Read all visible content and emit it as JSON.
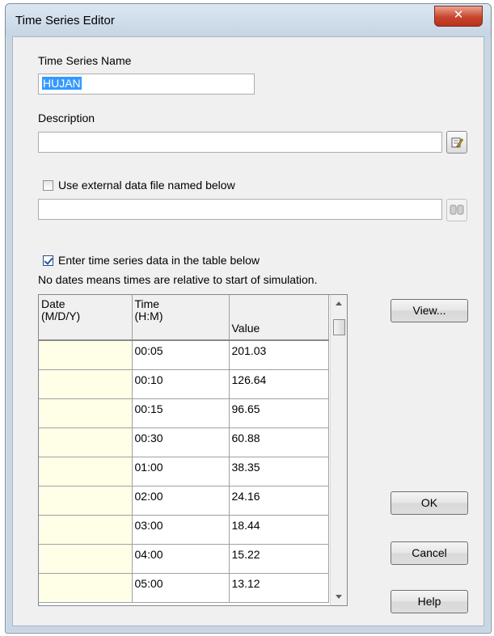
{
  "window": {
    "title": "Time Series Editor",
    "close_glyph": "✕"
  },
  "form": {
    "name_label": "Time Series Name",
    "name_value": "HUJAN",
    "description_label": "Description",
    "description_value": "",
    "edit_description_icon": "pencil-edit-icon",
    "use_external_label": "Use external data file named below",
    "use_external_checked": false,
    "external_file_value": "",
    "browse_file_icon": "binoculars-browse-icon",
    "enter_table_label": "Enter time series data in the table below",
    "enter_table_checked": true,
    "note": "No dates means times are relative to start of simulation."
  },
  "table": {
    "headers": {
      "date_line1": "Date",
      "date_line2": "(M/D/Y)",
      "time_line1": "Time",
      "time_line2": "(H:M)",
      "value": "Value"
    },
    "rows": [
      {
        "date": "",
        "time": "00:05",
        "value": "201.03"
      },
      {
        "date": "",
        "time": "00:10",
        "value": "126.64"
      },
      {
        "date": "",
        "time": "00:15",
        "value": "96.65"
      },
      {
        "date": "",
        "time": "00:30",
        "value": "60.88"
      },
      {
        "date": "",
        "time": "01:00",
        "value": "38.35"
      },
      {
        "date": "",
        "time": "02:00",
        "value": "24.16"
      },
      {
        "date": "",
        "time": "03:00",
        "value": "18.44"
      },
      {
        "date": "",
        "time": "04:00",
        "value": "15.22"
      },
      {
        "date": "",
        "time": "05:00",
        "value": "13.12"
      }
    ]
  },
  "buttons": {
    "view": "View...",
    "ok": "OK",
    "cancel": "Cancel",
    "help": "Help"
  }
}
